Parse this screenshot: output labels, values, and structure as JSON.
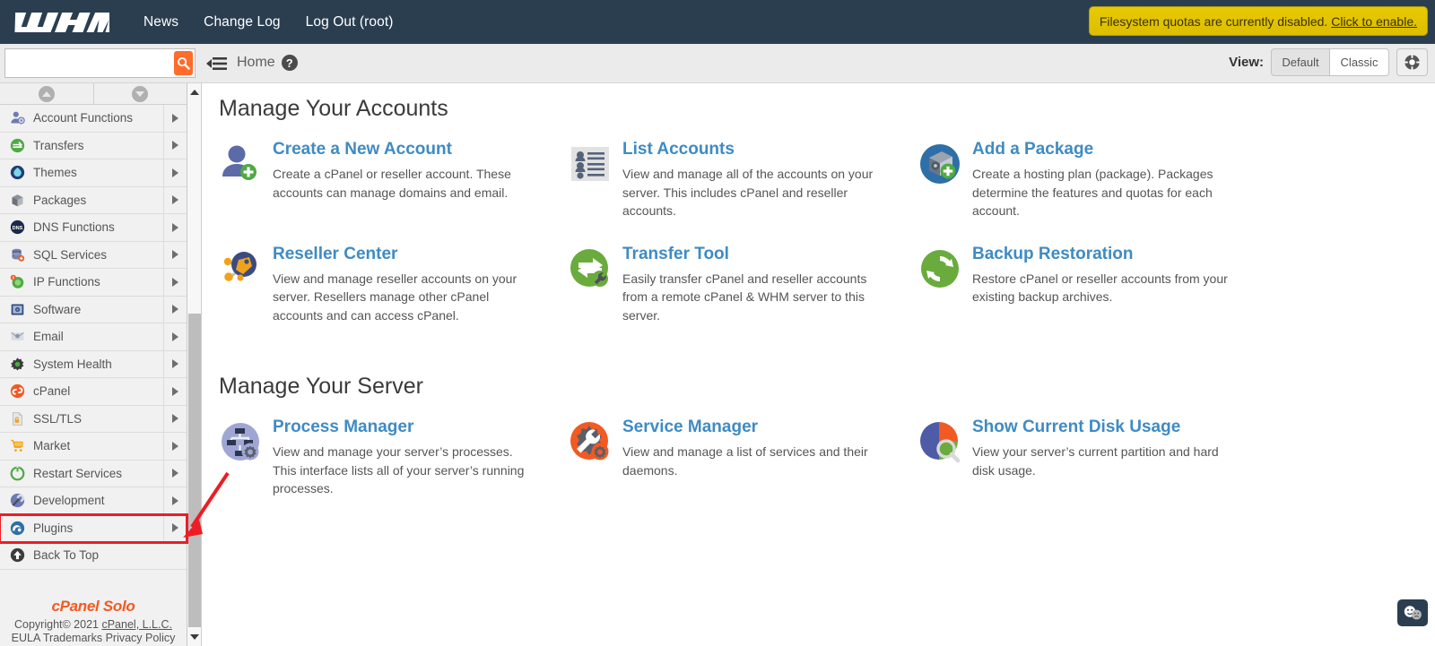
{
  "topbar": {
    "logo_text": "WHM",
    "links": [
      {
        "label": "News"
      },
      {
        "label": "Change Log"
      },
      {
        "label": "Log Out (root)"
      }
    ],
    "quota_notice": "Filesystem quotas are currently disabled.",
    "quota_action": "Click to enable."
  },
  "toolbar": {
    "search_placeholder": "",
    "search_value": "",
    "search_icon": "search-icon",
    "menu_icon": "hamburger-collapse-icon",
    "breadcrumb": "Home",
    "help_glyph": "?",
    "view_label": "View:",
    "view_options": [
      {
        "label": "Default",
        "selected": true
      },
      {
        "label": "Classic",
        "selected": false
      }
    ],
    "support_icon": "lifesaver-icon"
  },
  "sidebar": {
    "scroll_up_icon": "scroll-up-icon",
    "scroll_down_icon": "scroll-down-icon",
    "items": [
      {
        "label": "Account Functions",
        "icon": "account-functions-icon",
        "expandable": true,
        "highlighted": false
      },
      {
        "label": "Transfers",
        "icon": "transfers-icon",
        "expandable": true,
        "highlighted": false
      },
      {
        "label": "Themes",
        "icon": "themes-icon",
        "expandable": true,
        "highlighted": false
      },
      {
        "label": "Packages",
        "icon": "packages-icon",
        "expandable": true,
        "highlighted": false
      },
      {
        "label": "DNS Functions",
        "icon": "dns-icon",
        "expandable": true,
        "highlighted": false
      },
      {
        "label": "SQL Services",
        "icon": "sql-icon",
        "expandable": true,
        "highlighted": false
      },
      {
        "label": "IP Functions",
        "icon": "ip-icon",
        "expandable": true,
        "highlighted": false
      },
      {
        "label": "Software",
        "icon": "software-icon",
        "expandable": true,
        "highlighted": false
      },
      {
        "label": "Email",
        "icon": "email-icon",
        "expandable": true,
        "highlighted": false
      },
      {
        "label": "System Health",
        "icon": "system-health-icon",
        "expandable": true,
        "highlighted": false
      },
      {
        "label": "cPanel",
        "icon": "cpanel-icon",
        "expandable": true,
        "highlighted": false
      },
      {
        "label": "SSL/TLS",
        "icon": "ssl-icon",
        "expandable": true,
        "highlighted": false
      },
      {
        "label": "Market",
        "icon": "market-cart-icon",
        "expandable": true,
        "highlighted": false
      },
      {
        "label": "Restart Services",
        "icon": "restart-services-icon",
        "expandable": true,
        "highlighted": false
      },
      {
        "label": "Development",
        "icon": "development-icon",
        "expandable": true,
        "highlighted": false
      },
      {
        "label": "Plugins",
        "icon": "plugins-icon",
        "expandable": true,
        "highlighted": true
      },
      {
        "label": "Back To Top",
        "icon": "back-to-top-icon",
        "expandable": false,
        "highlighted": false
      }
    ],
    "footer": {
      "brand": "cPanel Solo",
      "copyright_prefix": "Copyright© 2021 ",
      "copyright_company": "cPanel, L.L.C.",
      "legal_links": [
        "EULA",
        "Trademarks",
        "Privacy Policy"
      ]
    }
  },
  "main": {
    "sections": [
      {
        "title": "Manage Your Accounts",
        "rows": [
          [
            {
              "title": "Create a New Account",
              "icon": "create-account-icon",
              "desc": "Create a cPanel or reseller account. These accounts can manage domains and email."
            },
            {
              "title": "List Accounts",
              "icon": "list-accounts-icon",
              "desc": "View and manage all of the accounts on your server. This includes cPanel and reseller accounts."
            },
            {
              "title": "Add a Package",
              "icon": "add-package-icon",
              "desc": "Create a hosting plan (package). Packages determine the features and quotas for each account."
            }
          ],
          [
            {
              "title": "Reseller Center",
              "icon": "reseller-center-icon",
              "desc": "View and manage reseller accounts on your server. Resellers manage other cPanel accounts and can access cPanel."
            },
            {
              "title": "Transfer Tool",
              "icon": "transfer-tool-icon",
              "desc": "Easily transfer cPanel and reseller accounts from a remote cPanel & WHM server to this server."
            },
            {
              "title": "Backup Restoration",
              "icon": "backup-restoration-icon",
              "desc": "Restore cPanel or reseller accounts from your existing backup archives."
            }
          ]
        ]
      },
      {
        "title": "Manage Your Server",
        "rows": [
          [
            {
              "title": "Process Manager",
              "icon": "process-manager-icon",
              "desc": "View and manage your server’s processes. This interface lists all of your server’s running processes."
            },
            {
              "title": "Service Manager",
              "icon": "service-manager-icon",
              "desc": "View and manage a list of services and their daemons."
            },
            {
              "title": "Show Current Disk Usage",
              "icon": "disk-usage-icon",
              "desc": "View your server’s current partition and hard disk usage."
            }
          ]
        ]
      }
    ]
  },
  "feedback": {
    "icon": "feedback-faces-icon"
  },
  "annotation": {
    "icon": "red-pointer-arrow",
    "color": "#ee1c25"
  },
  "colors": {
    "navy": "#2b3e50",
    "orange": "#ff6c2c",
    "link_blue": "#3e8bc4",
    "banner_yellow": "#e8c900",
    "highlight_red": "#ee1c25"
  }
}
